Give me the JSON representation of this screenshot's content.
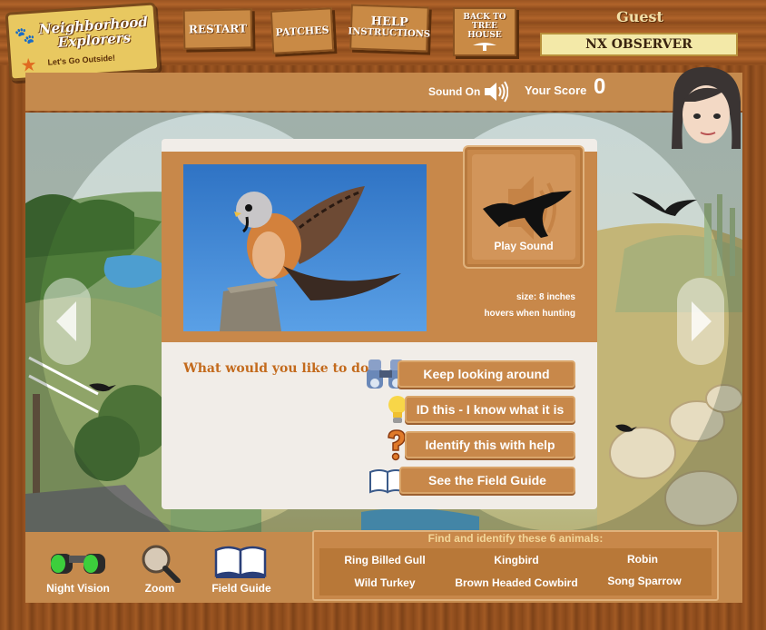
{
  "header": {
    "logo_title": "Neighborhood Explorers",
    "logo_tagline": "Let's Go Outside!",
    "nav": {
      "restart": "RESTART",
      "patches": "PATCHES",
      "help_top": "HELP",
      "help_bottom": "INSTRUCTIONS",
      "treehouse_top": "BACK TO",
      "treehouse_bottom": "TREE HOUSE"
    },
    "user_role": "Guest",
    "username": "NX OBSERVER"
  },
  "status": {
    "sound_label": "Sound On",
    "score_label": "Your Score",
    "score_value": "0"
  },
  "bird_card": {
    "play_sound_label": "Play Sound",
    "size_text": "size: 8 inches",
    "behavior_text": "hovers when hunting"
  },
  "actions": {
    "question": "What would you like to do?",
    "keep_looking": "Keep looking around",
    "id_this": "ID this - I know what it is",
    "identify_help": "Identify this with help",
    "field_guide": "See the Field Guide"
  },
  "tools": {
    "night_vision": "Night Vision",
    "zoom": "Zoom",
    "field_guide": "Field Guide"
  },
  "find_panel": {
    "title": "Find and identify these 6 animals:",
    "animals": [
      "Ring Billed Gull",
      "Kingbird",
      "Robin",
      "Wild Turkey",
      "Brown Headed Cowbird",
      "Song Sparrow"
    ]
  },
  "icons": {
    "speaker": "speaker-icon",
    "binoculars": "binoculars-icon",
    "lightbulb": "lightbulb-icon",
    "question": "question-mark-icon",
    "book": "book-icon",
    "magnifier": "magnifier-icon"
  },
  "colors": {
    "wood": "#9b5522",
    "panel": "#c8884a",
    "question_text": "#c36a1c",
    "username_bg": "#f3e9a8"
  }
}
